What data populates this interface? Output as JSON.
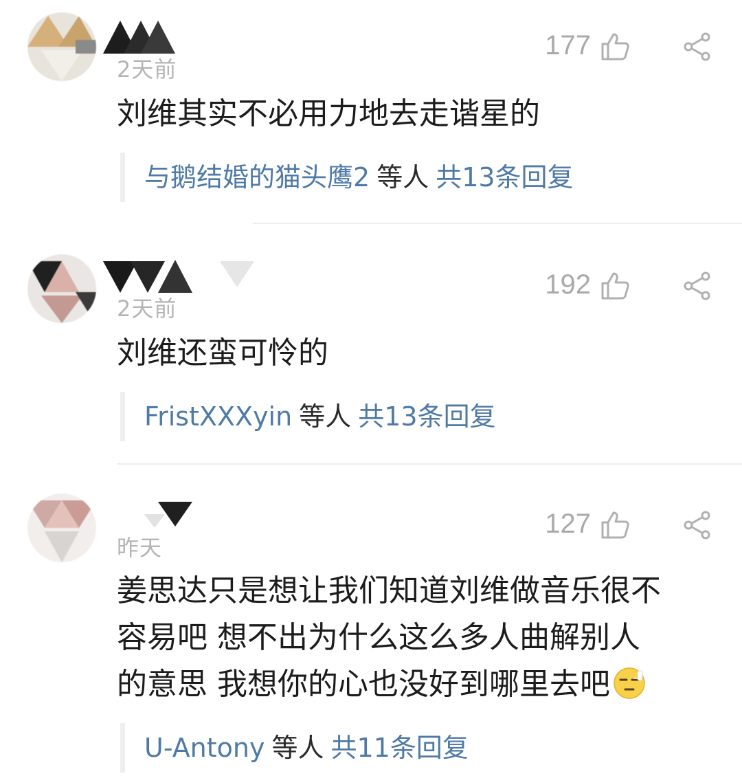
{
  "comments": [
    {
      "time": "2天前",
      "likes": "177",
      "text": "刘维其实不必用力地去走谐星的",
      "reply_users": "与鹅结婚的猫头鹰2",
      "reply_etc": "等人",
      "reply_total": "共13条回复"
    },
    {
      "time": "2天前",
      "likes": "192",
      "text": "刘维还蛮可怜的",
      "reply_users": "FristXXXyin",
      "reply_etc": "等人",
      "reply_total": "共13条回复"
    },
    {
      "time": "昨天",
      "likes": "127",
      "text_lines": [
        "姜思达只是想让我们知道刘维做音乐很不",
        "容易吧 想不出为什么这么多人曲解别人",
        "的意思 我想你的心也没好到哪里去吧"
      ],
      "emoji": "smirk-face-emoji",
      "reply_users": "U-Antony",
      "reply_etc": "等人",
      "reply_total": "共11条回复"
    }
  ],
  "icons": {
    "like": "thumbs-up-icon",
    "share": "share-icon"
  },
  "colors": {
    "reply_link": "#4f7aa6",
    "meta_gray": "#b4b4b4",
    "text": "#1c1c1c"
  }
}
